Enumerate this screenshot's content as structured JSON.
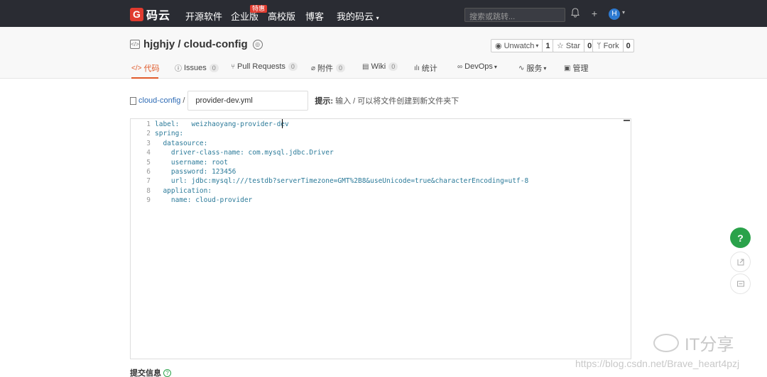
{
  "topbar": {
    "logo_mark": "G",
    "logo_text": "码云",
    "nav": [
      "开源软件",
      "企业版",
      "高校版",
      "博客",
      "我的码云"
    ],
    "hot_badge": "特惠",
    "search_placeholder": "搜索或跳转...",
    "avatar_initial": "H"
  },
  "repo": {
    "title": "hjghjy / cloud-config",
    "watch_label": "Unwatch",
    "watch_count": "1",
    "star_label": "Star",
    "star_count": "0",
    "fork_label": "Fork",
    "fork_count": "0"
  },
  "tabs": [
    {
      "label": "代码",
      "icon": "code-icon"
    },
    {
      "label": "Issues",
      "count": "0",
      "icon": "issue-icon"
    },
    {
      "label": "Pull Requests",
      "count": "0",
      "icon": "pull-request-icon"
    },
    {
      "label": "附件",
      "count": "0",
      "icon": "attachment-icon"
    },
    {
      "label": "Wiki",
      "count": "0",
      "icon": "wiki-icon"
    },
    {
      "label": "统计",
      "icon": "stats-icon"
    },
    {
      "label": "DevOps",
      "icon": "devops-icon"
    },
    {
      "label": "服务",
      "icon": "service-icon"
    },
    {
      "label": "管理",
      "icon": "manage-icon"
    }
  ],
  "path": {
    "repo_link": "cloud-config",
    "separator": "/",
    "filename": "provider-dev.yml",
    "hint_label": "提示:",
    "hint_text": "输入 / 可以将文件创建到新文件夹下"
  },
  "editor": {
    "lines": [
      "label:   weizhaoyang-provider-dev",
      "spring:",
      "  datasource:",
      "    driver-class-name: com.mysql.jdbc.Driver",
      "    username: root",
      "    password: 123456",
      "    url: jdbc:mysql:///testdb?serverTimezone=GMT%2B8&useUnicode=true&characterEncoding=utf-8",
      "  application:",
      "    name: cloud-provider"
    ]
  },
  "footer": {
    "commit_label": "提交信息"
  },
  "floating": {
    "help": "?"
  },
  "watermark": {
    "brand": "IT分享",
    "url": "https://blog.csdn.net/Brave_heart4pzj"
  }
}
